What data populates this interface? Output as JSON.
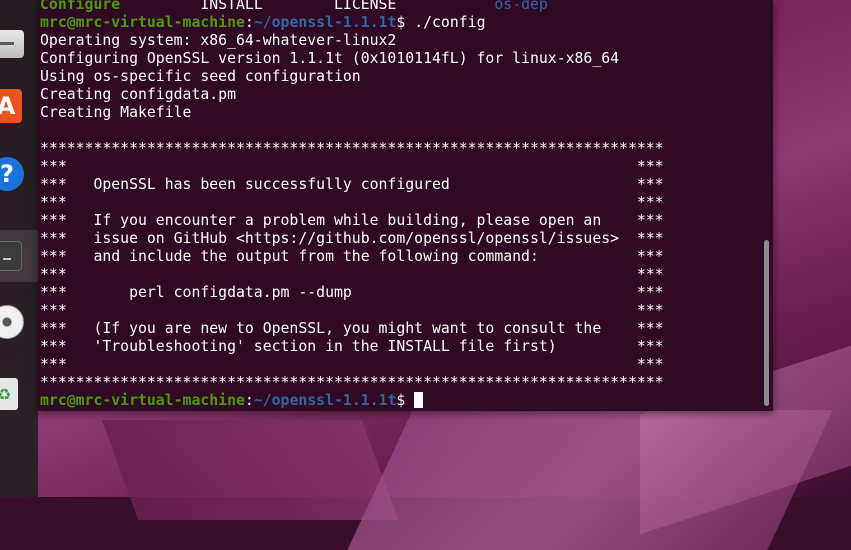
{
  "dock": {
    "items": [
      {
        "name": "files",
        "glyph": ""
      },
      {
        "name": "software-store",
        "glyph": "A"
      },
      {
        "name": "help",
        "glyph": "?"
      },
      {
        "name": "terminal",
        "glyph": ""
      },
      {
        "name": "disc",
        "glyph": ""
      },
      {
        "name": "trash",
        "glyph": "♻"
      }
    ]
  },
  "terminal": {
    "ls_line": {
      "col1": "Configure",
      "col2": "INSTALL",
      "col3": "LICENSE",
      "col4": "os-dep"
    },
    "prompt": {
      "user_host": "mrc@mrc-virtual-machine",
      "sep": ":",
      "path": "~/openssl-1.1.1t",
      "symbol": "$",
      "command": " ./config"
    },
    "output_lines": [
      "Operating system: x86_64-whatever-linux2",
      "Configuring OpenSSL version 1.1.1t (0x1010114fL) for linux-x86_64",
      "Using os-specific seed configuration",
      "Creating configdata.pm",
      "Creating Makefile",
      "",
      "**********************************************************************",
      "***                                                                ***",
      "***   OpenSSL has been successfully configured                     ***",
      "***                                                                ***",
      "***   If you encounter a problem while building, please open an    ***",
      "***   issue on GitHub <https://github.com/openssl/openssl/issues>  ***",
      "***   and include the output from the following command:           ***",
      "***                                                                ***",
      "***       perl configdata.pm --dump                                ***",
      "***                                                                ***",
      "***   (If you are new to OpenSSL, you might want to consult the    ***",
      "***   'Troubleshooting' section in the INSTALL file first)         ***",
      "***                                                                ***",
      "**********************************************************************"
    ],
    "final_prompt": {
      "user_host": "mrc@mrc-virtual-machine",
      "sep": ":",
      "path": "~/openssl-1.1.1t",
      "symbol": "$ "
    }
  },
  "colors": {
    "terminal_bg": "#300a24",
    "prompt_green": "#4e9a06",
    "prompt_blue": "#3465a4",
    "text": "#ffffff"
  }
}
